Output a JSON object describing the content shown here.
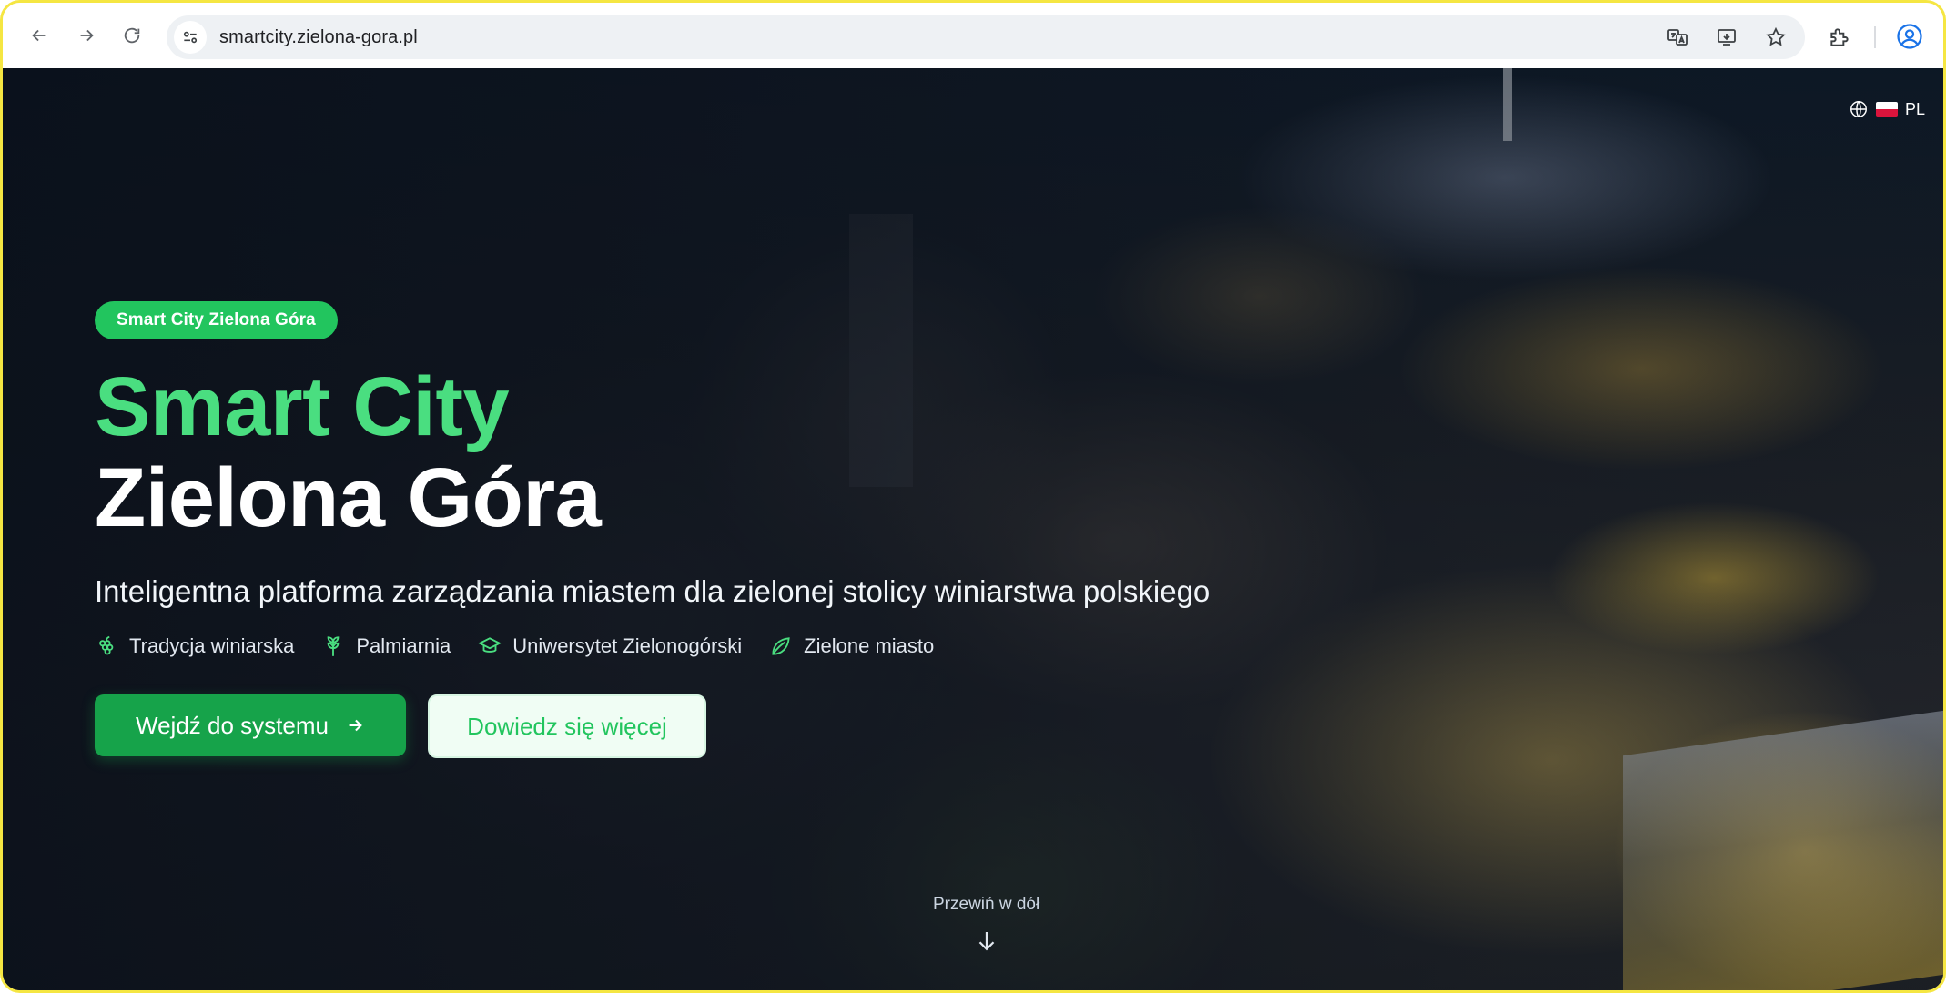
{
  "browser": {
    "url": "smartcity.zielona-gora.pl",
    "icons": {
      "back": "arrow-left-icon",
      "forward": "arrow-right-icon",
      "reload": "reload-icon",
      "site_info": "tune-icon",
      "translate": "translate-icon",
      "install": "install-app-icon",
      "bookmark": "star-icon",
      "extensions": "puzzle-icon",
      "profile": "account-circle-icon"
    }
  },
  "language": {
    "code": "PL"
  },
  "hero": {
    "badge": "Smart City Zielona Góra",
    "title_line1": "Smart City",
    "title_line2": "Zielona Góra",
    "subtitle": "Inteligentna platforma zarządzania miastem dla zielonej stolicy winiarstwa polskiego",
    "features": [
      {
        "label": "Tradycja winiarska",
        "icon": "grapes-icon"
      },
      {
        "label": "Palmiarnia",
        "icon": "plant-icon"
      },
      {
        "label": "Uniwersytet Zielonogórski",
        "icon": "graduation-cap-icon"
      },
      {
        "label": "Zielone miasto",
        "icon": "leaf-icon"
      }
    ],
    "primary_button": "Wejdź do systemu",
    "secondary_button": "Dowiedz się więcej"
  },
  "scroll_hint": "Przewiń w dół",
  "colors": {
    "accent": "#22c55e",
    "accent_dark": "#16a34a",
    "title_green": "#4ade80",
    "frame": "#f5e642"
  }
}
